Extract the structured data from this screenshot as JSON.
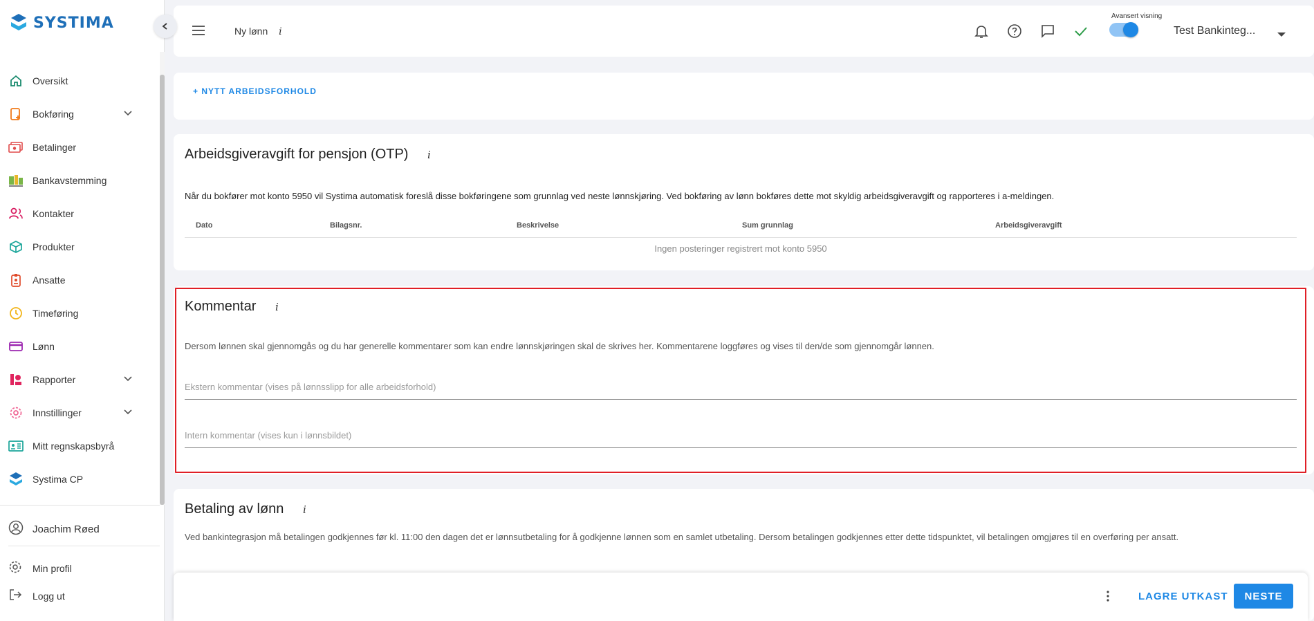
{
  "sidebar": {
    "logo_text": "SYSTIMA",
    "items": [
      {
        "label": "Oversikt",
        "icon": "home-icon"
      },
      {
        "label": "Bokføring",
        "icon": "bookkeeping-icon"
      },
      {
        "label": "Betalinger",
        "icon": "payments-icon"
      },
      {
        "label": "Bankavstemming",
        "icon": "bank-reconciliation-icon"
      },
      {
        "label": "Kontakter",
        "icon": "contacts-icon"
      },
      {
        "label": "Produkter",
        "icon": "products-icon"
      },
      {
        "label": "Ansatte",
        "icon": "employees-icon"
      },
      {
        "label": "Timeføring",
        "icon": "clock-icon"
      },
      {
        "label": "Lønn",
        "icon": "salary-card-icon"
      },
      {
        "label": "Rapporter",
        "icon": "reports-icon"
      },
      {
        "label": "Innstillinger",
        "icon": "settings-icon"
      },
      {
        "label": "Mitt regnskapsbyrå",
        "icon": "id-card-icon"
      },
      {
        "label": "Systima CP",
        "icon": "systima-logo-icon"
      }
    ],
    "user_name": "Joachim Røed",
    "profile_label": "Min profil",
    "logout_label": "Logg ut"
  },
  "topbar": {
    "page_title": "Ny lønn",
    "info": "i",
    "advanced_view_label": "Avansert visning",
    "advanced_view_on": true,
    "company_name": "Test Bankinteg..."
  },
  "employment": {
    "add_label": "+ NYTT ARBEIDSFORHOLD"
  },
  "otp": {
    "title": "Arbeidsgiveravgift for pensjon (OTP)",
    "info": "i",
    "description": "Når du bokfører mot konto 5950 vil Systima automatisk foreslå disse bokføringene som grunnlag ved neste lønnskjøring. Ved bokføring av lønn bokføres dette mot skyldig arbeidsgiveravgift og rapporteres i a-meldingen.",
    "columns": [
      "Dato",
      "Bilagsnr.",
      "Beskrivelse",
      "Sum grunnlag",
      "Arbeidsgiveravgift"
    ],
    "empty_text": "Ingen posteringer registrert mot konto 5950"
  },
  "comment": {
    "title": "Kommentar",
    "info": "i",
    "description": "Dersom lønnen skal gjennomgås og du har generelle kommentarer som kan endre lønnskjøringen skal de skrives her. Kommentarene loggføres og vises til den/de som gjennomgår lønnen.",
    "external_placeholder": "Ekstern kommentar (vises på lønnsslipp for alle arbeidsforhold)",
    "internal_placeholder": "Intern kommentar (vises kun i lønnsbildet)"
  },
  "payment": {
    "title": "Betaling av lønn",
    "info": "i",
    "description": "Ved bankintegrasjon må betalingen godkjennes før kl. 11:00 den dagen det er lønnsutbetaling for å godkjenne lønnen som en samlet utbetaling. Dersom betalingen godkjennes etter dette tidspunktet, vil betalingen omgjøres til en overføring per ansatt."
  },
  "footer": {
    "draft_label": "LAGRE UTKAST",
    "next_label": "NESTE"
  },
  "colors": {
    "accent": "#1e88e5",
    "highlight_border": "#e01f26",
    "brand": "#1e6fb8"
  }
}
